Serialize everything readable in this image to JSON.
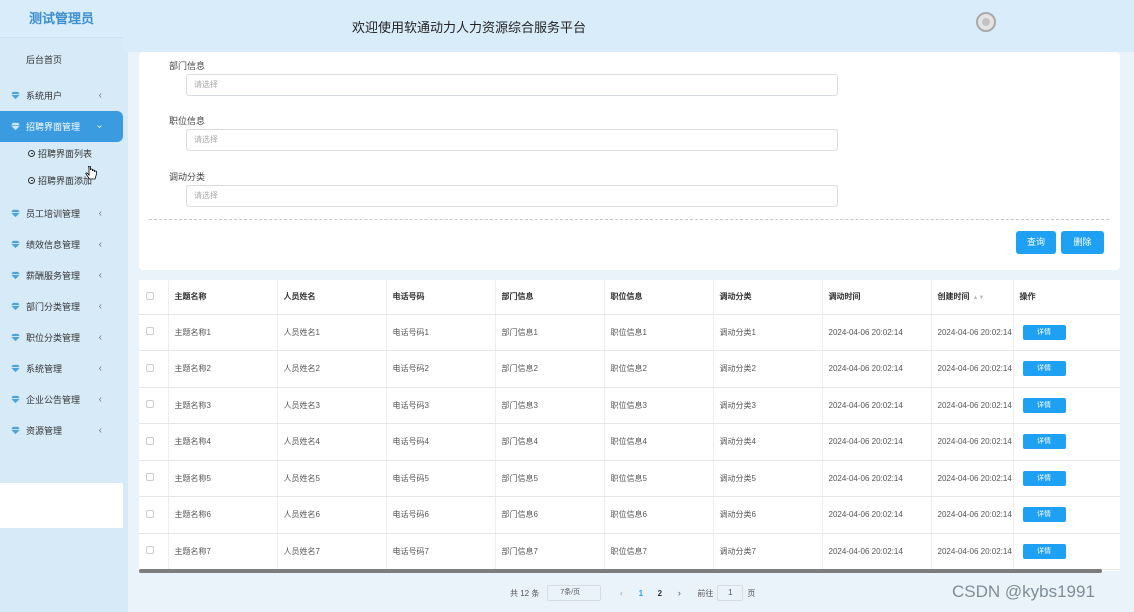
{
  "app": {
    "brand": "测试管理员",
    "title": "欢迎使用软通动力人力资源综合服务平台",
    "accent_color": "#1ea0f3"
  },
  "sidebar": {
    "home": "后台首页",
    "items": [
      {
        "label": "系统用户",
        "icon": "gem-icon"
      },
      {
        "label": "招聘界面管理",
        "icon": "gem-icon",
        "active": true
      },
      {
        "label": "员工培训管理",
        "icon": "gem-icon"
      },
      {
        "label": "绩效信息管理",
        "icon": "gem-icon"
      },
      {
        "label": "薪酬服务管理",
        "icon": "gem-icon"
      },
      {
        "label": "部门分类管理",
        "icon": "gem-icon"
      },
      {
        "label": "职位分类管理",
        "icon": "gem-icon"
      },
      {
        "label": "系统管理",
        "icon": "gem-icon"
      },
      {
        "label": "企业公告管理",
        "icon": "gem-icon"
      },
      {
        "label": "资源管理",
        "icon": "gem-icon"
      }
    ],
    "sub_items": [
      {
        "label": "招聘界面列表"
      },
      {
        "label": "招聘界面添加"
      }
    ]
  },
  "filters": [
    {
      "label": "部门信息",
      "placeholder": "请选择"
    },
    {
      "label": "职位信息",
      "placeholder": "请选择"
    },
    {
      "label": "调动分类",
      "placeholder": "请选择"
    }
  ],
  "actions": {
    "query": "查询",
    "delete": "删除"
  },
  "table": {
    "columns": [
      "主题名称",
      "人员姓名",
      "电话号码",
      "部门信息",
      "职位信息",
      "调动分类",
      "调动时间",
      "创建时间",
      "操作"
    ],
    "detail_label": "详情",
    "rows": [
      [
        "主题名称1",
        "人员姓名1",
        "电话号码1",
        "部门信息1",
        "职位信息1",
        "调动分类1",
        "2024-04-06 20:02:14",
        "2024-04-06 20:02:14"
      ],
      [
        "主题名称2",
        "人员姓名2",
        "电话号码2",
        "部门信息2",
        "职位信息2",
        "调动分类2",
        "2024-04-06 20:02:14",
        "2024-04-06 20:02:14"
      ],
      [
        "主题名称3",
        "人员姓名3",
        "电话号码3",
        "部门信息3",
        "职位信息3",
        "调动分类3",
        "2024-04-06 20:02:14",
        "2024-04-06 20:02:14"
      ],
      [
        "主题名称4",
        "人员姓名4",
        "电话号码4",
        "部门信息4",
        "职位信息4",
        "调动分类4",
        "2024-04-06 20:02:14",
        "2024-04-06 20:02:14"
      ],
      [
        "主题名称5",
        "人员姓名5",
        "电话号码5",
        "部门信息5",
        "职位信息5",
        "调动分类5",
        "2024-04-06 20:02:14",
        "2024-04-06 20:02:14"
      ],
      [
        "主题名称6",
        "人员姓名6",
        "电话号码6",
        "部门信息6",
        "职位信息6",
        "调动分类6",
        "2024-04-06 20:02:14",
        "2024-04-06 20:02:14"
      ],
      [
        "主题名称7",
        "人员姓名7",
        "电话号码7",
        "部门信息7",
        "职位信息7",
        "调动分类7",
        "2024-04-06 20:02:14",
        "2024-04-06 20:02:14"
      ]
    ]
  },
  "pagination": {
    "total": "共 12 条",
    "page_size": "7条/页",
    "pages": [
      "1",
      "2"
    ],
    "current": "1",
    "goto_label": "前往",
    "goto_value": "1",
    "page_suffix": "页"
  },
  "watermark": "CSDN @kybs1991"
}
